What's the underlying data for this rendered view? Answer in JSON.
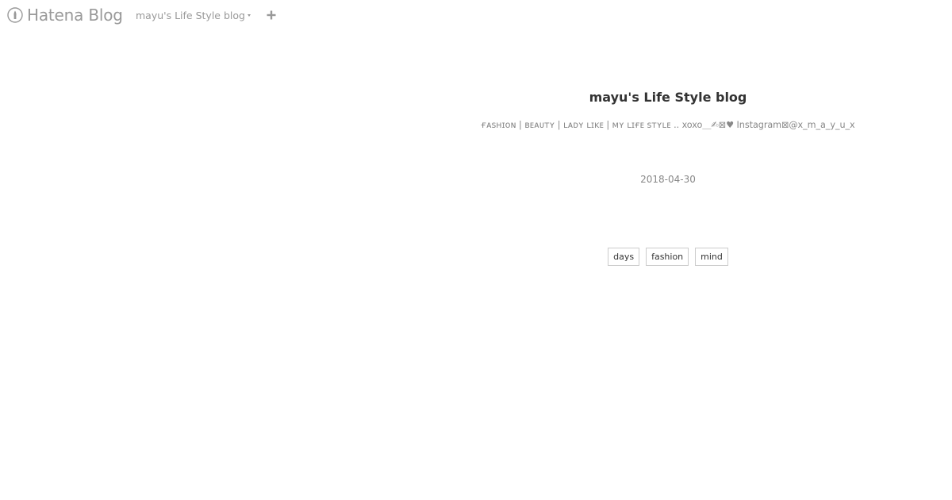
{
  "topbar": {
    "brand_text": "Hatena Blog",
    "brand_icon": "hatena-logo-icon",
    "blog_switcher_label": "mayu's Life Style blog",
    "plus_icon": "plus-icon"
  },
  "blog": {
    "title": "mayu's Life Style blog",
    "description": "ғᴀsʜɪᴏɴ | ʙᴇᴀᴜᴛʏ | ʟᴀᴅʏ ʟɪᴋᴇ | ᴍʏ ʟɪғᴇ sᴛʏʟᴇ .. xoxo＿✍︎⊠♥ Instagram⊠@x_m_a_y_u_x"
  },
  "entry": {
    "date": "2018-04-30",
    "categories": [
      "days",
      "fashion",
      "mind"
    ]
  },
  "colors": {
    "muted_text": "#999999",
    "title_text": "#333333",
    "tag_border": "#cccccc"
  }
}
